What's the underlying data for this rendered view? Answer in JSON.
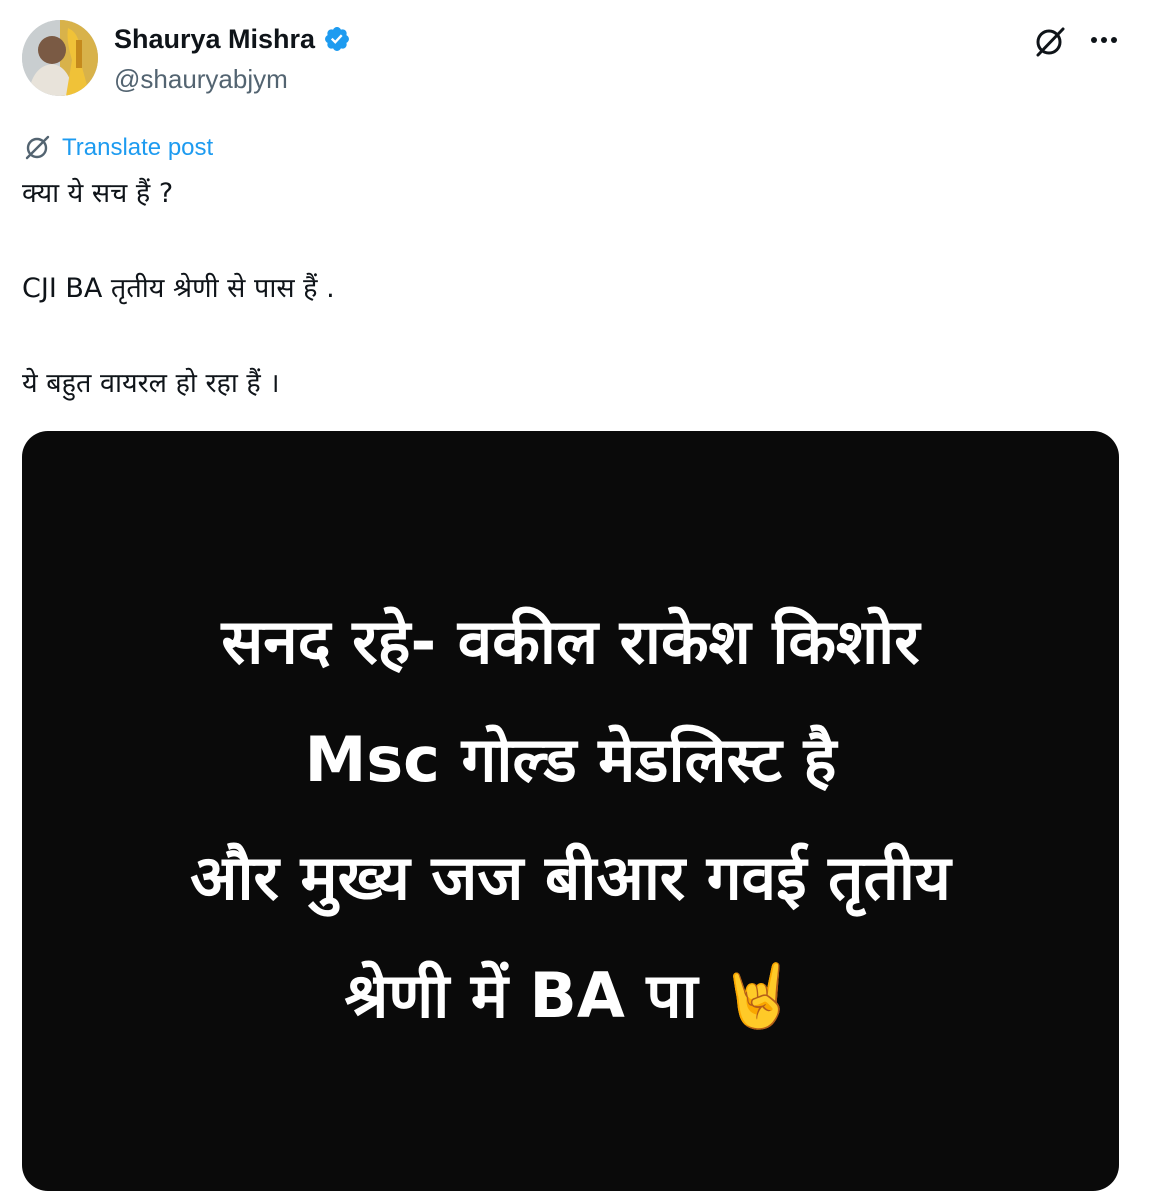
{
  "author": {
    "name": "Shaurya Mishra",
    "handle": "@shauryabjym",
    "verified": true,
    "verified_color": "#1d9bf0"
  },
  "actions": {
    "grok_icon": "grok-icon",
    "more_icon": "more-options-icon",
    "more_label": "···"
  },
  "translate": {
    "label": "Translate post",
    "icon": "translate-icon",
    "color": "#1d9bf0"
  },
  "post": {
    "lines": [
      "क्या ये सच हैं ?",
      "CJI BA तृतीय श्रेणी से पास हैं .",
      "ये बहुत वायरल हो रहा हैं ।"
    ]
  },
  "media": {
    "background": "#0a0a0a",
    "text_color": "#ffffff",
    "lines": [
      "सनद रहे- वकील राकेश किशोर",
      "Msc गोल्ड मेडलिस्ट है",
      "और मुख्य जज बीआर गवई तृतीय",
      "श्रेणी में BA पा"
    ],
    "emoji": "🤘"
  }
}
